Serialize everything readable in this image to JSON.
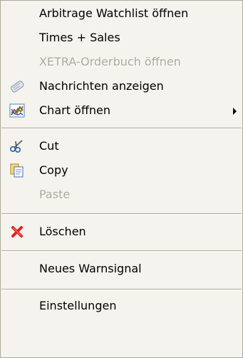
{
  "menu": {
    "items": {
      "arbitrage": {
        "label": "Arbitrage Watchlist öffnen",
        "enabled": true
      },
      "times_sales": {
        "label": "Times + Sales",
        "enabled": true
      },
      "xetra": {
        "label": "XETRA-Orderbuch öffnen",
        "enabled": false
      },
      "news": {
        "label": "Nachrichten anzeigen",
        "enabled": true,
        "icon": "news-icon"
      },
      "chart": {
        "label": "Chart öffnen",
        "enabled": true,
        "icon": "chart-icon",
        "has_submenu": true
      },
      "cut": {
        "label": "Cut",
        "enabled": true,
        "icon": "scissors-icon"
      },
      "copy": {
        "label": "Copy",
        "enabled": true,
        "icon": "copy-icon"
      },
      "paste": {
        "label": "Paste",
        "enabled": false
      },
      "delete": {
        "label": "Löschen",
        "enabled": true,
        "icon": "red-x-icon"
      },
      "alert": {
        "label": "Neues Warnsignal",
        "enabled": true
      },
      "settings": {
        "label": "Einstellungen",
        "enabled": true
      }
    }
  },
  "colors": {
    "menu_background": "#f4f3ee",
    "menu_border": "#aca899",
    "disabled_text": "#aca899",
    "delete_icon": "#e02020"
  }
}
